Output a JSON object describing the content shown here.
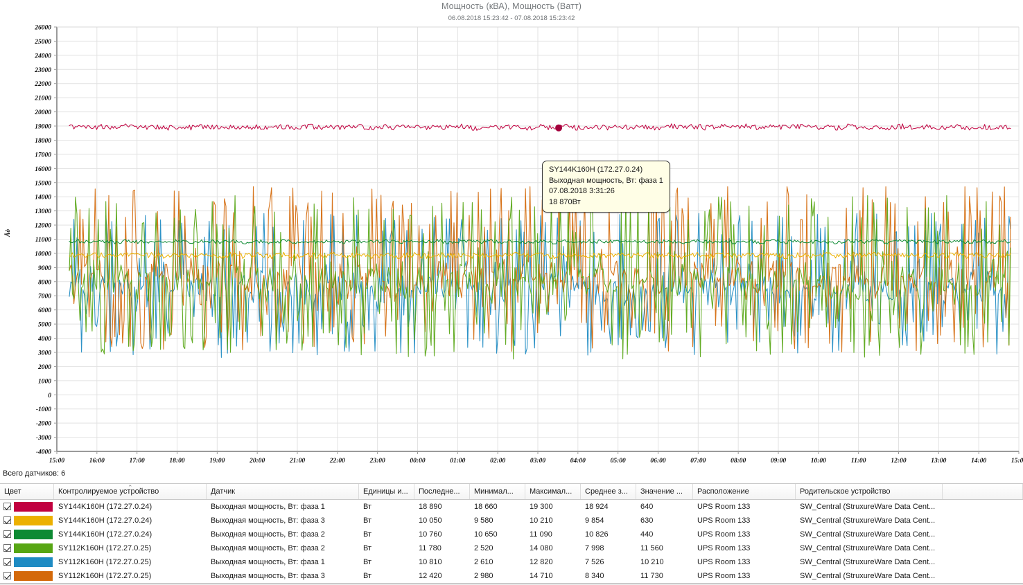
{
  "chart_data": {
    "type": "line",
    "title": "Мощность (кВА), Мощность (Ватт)",
    "subtitle": "06.08.2018 15:23:42 - 07.08.2018 15:23:42",
    "ylabel": "Åò",
    "xlabel": "",
    "ylim": [
      -4000,
      26000
    ],
    "ytick_step": 1000,
    "yticks": [
      "26000",
      "25000",
      "24000",
      "23000",
      "22000",
      "21000",
      "20000",
      "19000",
      "18000",
      "17000",
      "16000",
      "15000",
      "14000",
      "13000",
      "12000",
      "11000",
      "10000",
      "9000",
      "8000",
      "7000",
      "6000",
      "5000",
      "4000",
      "3000",
      "2000",
      "1000",
      "0",
      "-1000",
      "-2000",
      "-3000",
      "-4000"
    ],
    "xticks": [
      "15:00",
      "16:00",
      "17:00",
      "18:00",
      "19:00",
      "20:00",
      "21:00",
      "22:00",
      "23:00",
      "00:00",
      "01:00",
      "02:00",
      "03:00",
      "04:00",
      "05:00",
      "06:00",
      "07:00",
      "08:00",
      "09:00",
      "10:00",
      "11:00",
      "12:00",
      "13:00",
      "14:00",
      "15:00"
    ],
    "grid": true,
    "legend_position": "table-below",
    "series": [
      {
        "name": "SY144K160H (172.27.0.24) — Выходная мощность, Вт: фаза 1",
        "color": "#c1003f",
        "mean": 18924,
        "min": 18660,
        "max": 19300,
        "last": 18890,
        "volatility": "low"
      },
      {
        "name": "SY144K160H (172.27.0.24) — Выходная мощность, Вт: фаза 3",
        "color": "#ecb000",
        "mean": 9854,
        "min": 9580,
        "max": 10210,
        "last": 10050,
        "volatility": "low"
      },
      {
        "name": "SY144K160H (172.27.0.24) — Выходная мощность, Вт: фаза 2",
        "color": "#0d8a33",
        "mean": 10826,
        "min": 10650,
        "max": 11090,
        "last": 10760,
        "volatility": "low"
      },
      {
        "name": "SY112K160H (172.27.0.25) — Выходная мощность, Вт: фаза 2",
        "color": "#57a614",
        "mean": 7998,
        "min": 2520,
        "max": 14080,
        "last": 11780,
        "volatility": "high"
      },
      {
        "name": "SY112K160H (172.27.0.25) — Выходная мощность, Вт: фаза 1",
        "color": "#1e8bc3",
        "mean": 7526,
        "min": 2610,
        "max": 12820,
        "last": 10810,
        "volatility": "high"
      },
      {
        "name": "SY112K160H (172.27.0.25) — Выходная мощность, Вт: фаза 3",
        "color": "#d4690a",
        "mean": 8340,
        "min": 2980,
        "max": 14710,
        "last": 12420,
        "volatility": "high"
      }
    ]
  },
  "tooltip": {
    "device": "SY144K160H (172.27.0.24)",
    "sensor": "Выходная мощность, Вт: фаза 1",
    "timestamp": "07.08.2018 3:31:26",
    "value": "18 870Вт"
  },
  "footer": {
    "sensor_count_label": "Всего датчиков: 6"
  },
  "table": {
    "columns": [
      {
        "label": "Цвет"
      },
      {
        "label": "Контролируемое устройство",
        "sorted": "asc"
      },
      {
        "label": "Датчик"
      },
      {
        "label": "Единицы и..."
      },
      {
        "label": "Последне..."
      },
      {
        "label": "Минимал..."
      },
      {
        "label": "Максимал..."
      },
      {
        "label": "Среднее з..."
      },
      {
        "label": "Значение ..."
      },
      {
        "label": "Расположение"
      },
      {
        "label": "Родительское устройство"
      }
    ],
    "rows": [
      {
        "color": "#c1003f",
        "device": "SY144K160H (172.27.0.24)",
        "sensor": "Выходная мощность, Вт: фаза 1",
        "unit": "Вт",
        "last": "18 890",
        "min": "18 660",
        "max": "19 300",
        "avg": "18 924",
        "delta": "640",
        "location": "UPS Room 133",
        "parent": "SW_Central (StruxureWare Data Cent..."
      },
      {
        "color": "#ecb000",
        "device": "SY144K160H (172.27.0.24)",
        "sensor": "Выходная мощность, Вт: фаза 3",
        "unit": "Вт",
        "last": "10 050",
        "min": "9 580",
        "max": "10 210",
        "avg": "9 854",
        "delta": "630",
        "location": "UPS Room 133",
        "parent": "SW_Central (StruxureWare Data Cent..."
      },
      {
        "color": "#0d8a33",
        "device": "SY144K160H (172.27.0.24)",
        "sensor": "Выходная мощность, Вт: фаза 2",
        "unit": "Вт",
        "last": "10 760",
        "min": "10 650",
        "max": "11 090",
        "avg": "10 826",
        "delta": "440",
        "location": "UPS Room 133",
        "parent": "SW_Central (StruxureWare Data Cent..."
      },
      {
        "color": "#57a614",
        "device": "SY112K160H (172.27.0.25)",
        "sensor": "Выходная мощность, Вт: фаза 2",
        "unit": "Вт",
        "last": "11 780",
        "min": "2 520",
        "max": "14 080",
        "avg": "7 998",
        "delta": "11 560",
        "location": "UPS Room 133",
        "parent": "SW_Central (StruxureWare Data Cent..."
      },
      {
        "color": "#1e8bc3",
        "device": "SY112K160H (172.27.0.25)",
        "sensor": "Выходная мощность, Вт: фаза 1",
        "unit": "Вт",
        "last": "10 810",
        "min": "2 610",
        "max": "12 820",
        "avg": "7 526",
        "delta": "10 210",
        "location": "UPS Room 133",
        "parent": "SW_Central (StruxureWare Data Cent..."
      },
      {
        "color": "#d4690a",
        "device": "SY112K160H (172.27.0.25)",
        "sensor": "Выходная мощность, Вт: фаза 3",
        "unit": "Вт",
        "last": "12 420",
        "min": "2 980",
        "max": "14 710",
        "avg": "8 340",
        "delta": "11 730",
        "location": "UPS Room 133",
        "parent": "SW_Central (StruxureWare Data Cent..."
      }
    ]
  }
}
